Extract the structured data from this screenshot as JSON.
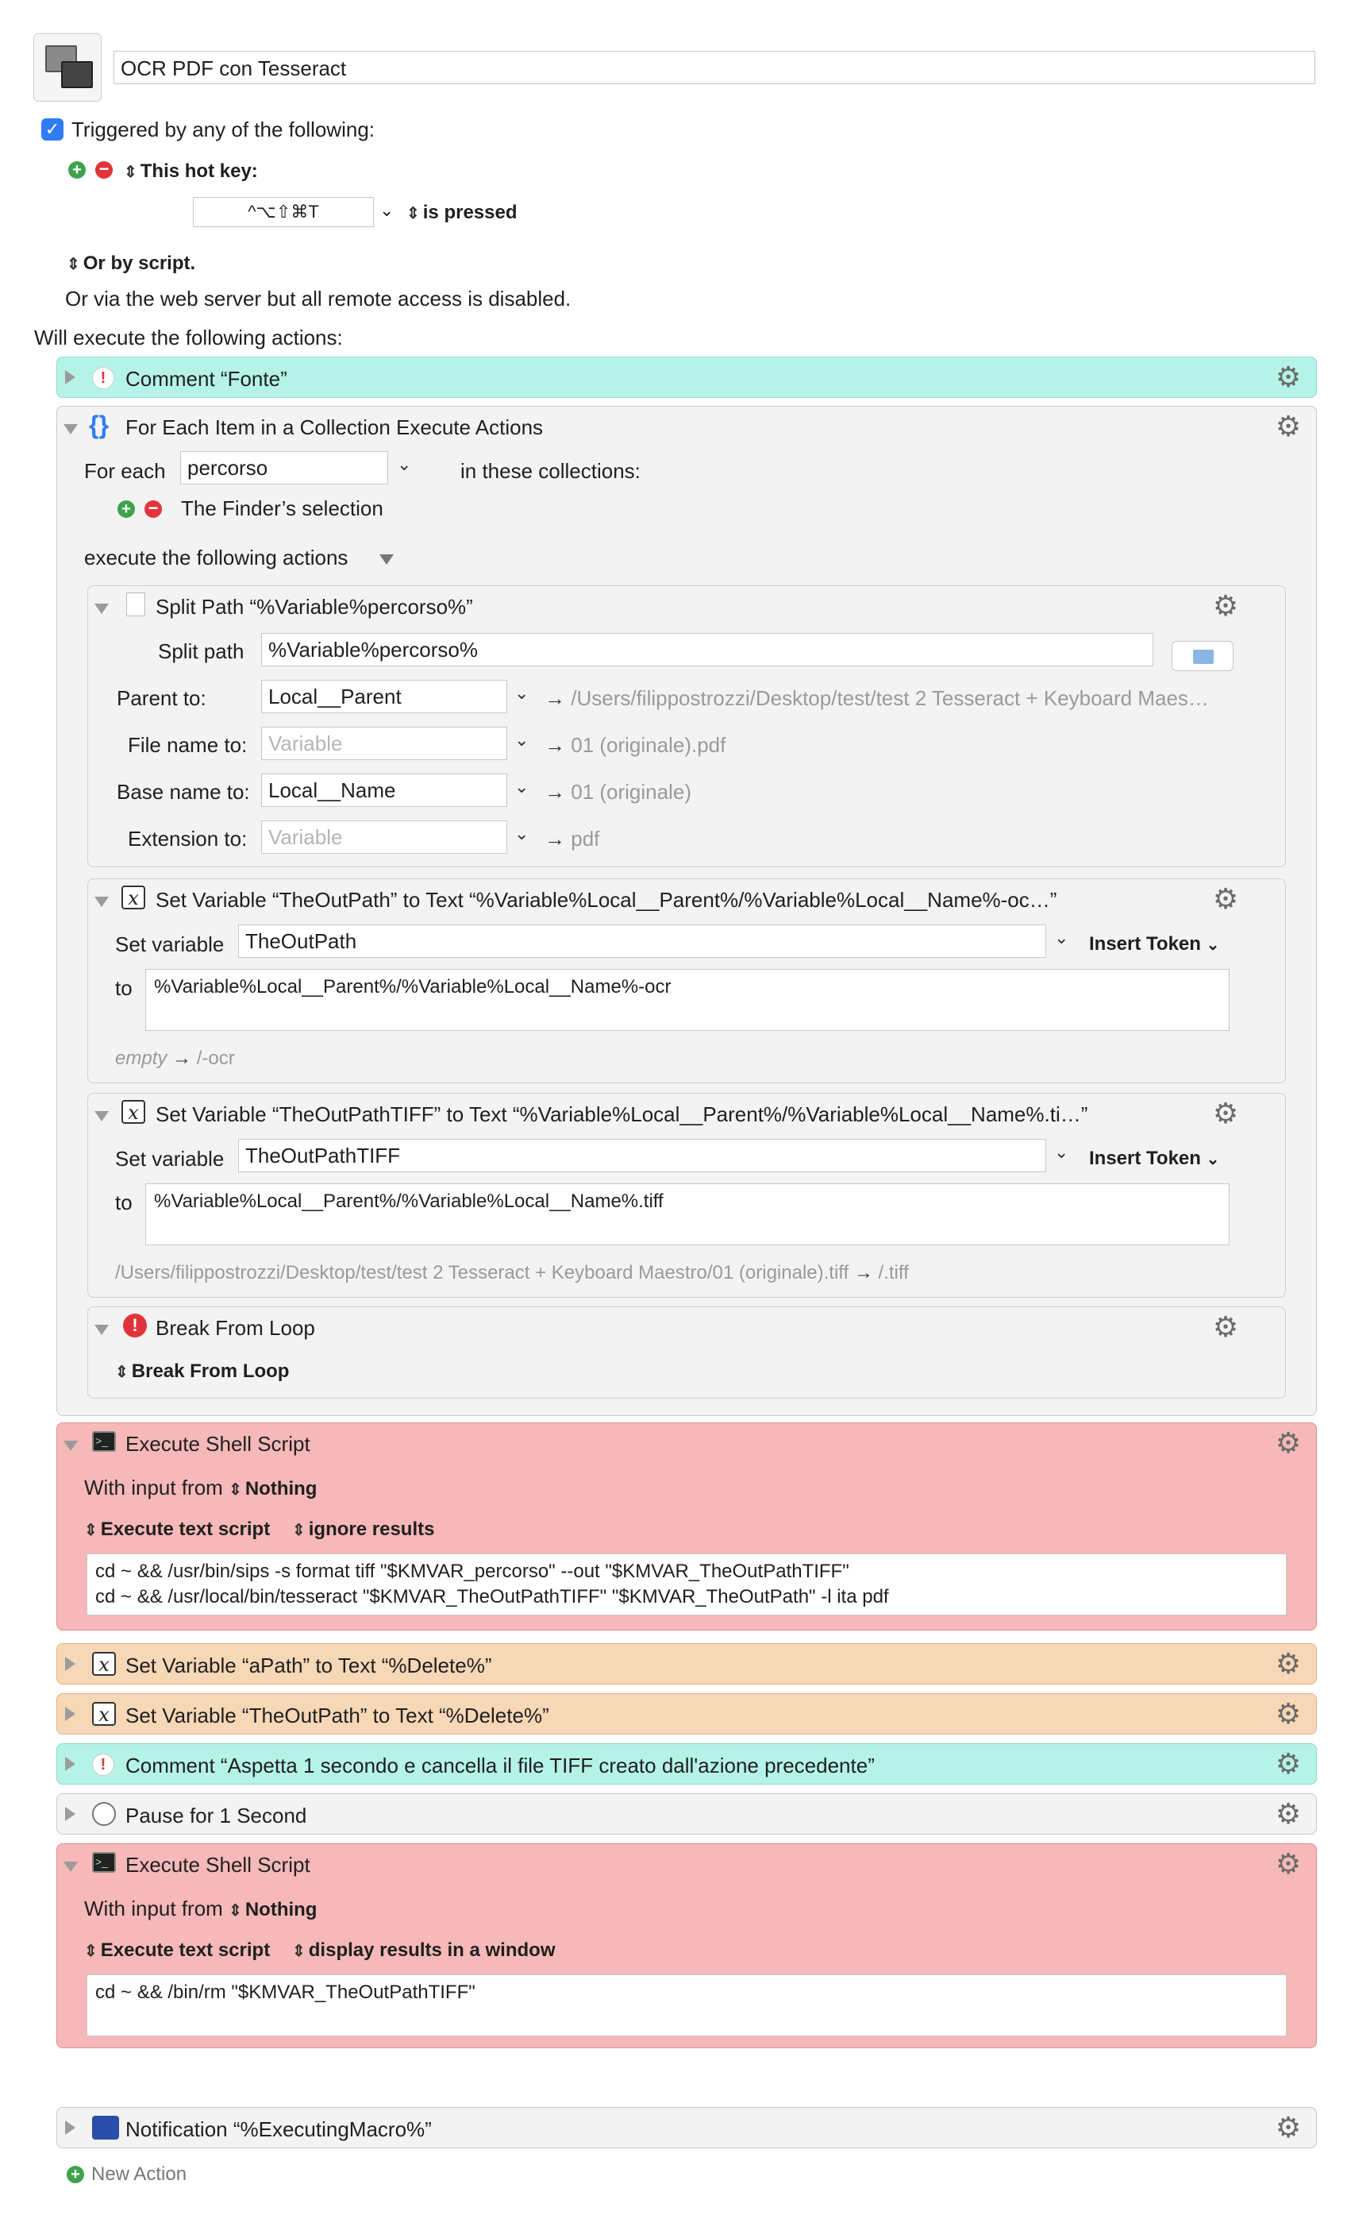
{
  "macro": {
    "name": "OCR PDF con Tesseract",
    "triggered_label": "Triggered by any of the following:",
    "hotkey_label": "This hot key:",
    "hotkey_value": "^⌥⇧⌘T",
    "hotkey_condition": "is pressed",
    "or_by_script": "Or by script.",
    "web_server_note": "Or via the web server but all remote access is disabled.",
    "will_execute": "Will execute the following actions:"
  },
  "actions": {
    "comment_fonte": "Comment “Fonte”",
    "foreach": {
      "title": "For Each Item in a Collection Execute Actions",
      "for_each_label": "For each",
      "variable": "percorso",
      "in_collections": "in these collections:",
      "collection": "The Finder’s selection",
      "execute_label": "execute the following actions"
    },
    "split": {
      "title": "Split Path “%Variable%percorso%”",
      "split_path_label": "Split path",
      "split_path_value": "%Variable%percorso%",
      "parent_label": "Parent to:",
      "parent_value": "Local__Parent",
      "parent_result": "/Users/filippostrozzi/Desktop/test/test 2 Tesseract + Keyboard Maes…",
      "filename_label": "File name to:",
      "filename_placeholder": "Variable",
      "filename_result": "01 (originale).pdf",
      "basename_label": "Base name to:",
      "basename_value": "Local__Name",
      "basename_result": "01 (originale)",
      "ext_label": "Extension to:",
      "ext_placeholder": "Variable",
      "ext_result": "pdf"
    },
    "setvar1": {
      "title": "Set Variable “TheOutPath” to Text “%Variable%Local__Parent%/%Variable%Local__Name%-oc…”",
      "set_label": "Set variable",
      "var_name": "TheOutPath",
      "insert_token": "Insert Token",
      "to_label": "to",
      "text": "%Variable%Local__Parent%/%Variable%Local__Name%-ocr",
      "preview_empty": "empty",
      "preview_result": "/-ocr"
    },
    "setvar2": {
      "title": "Set Variable “TheOutPathTIFF” to Text “%Variable%Local__Parent%/%Variable%Local__Name%.ti…”",
      "set_label": "Set variable",
      "var_name": "TheOutPathTIFF",
      "insert_token": "Insert Token",
      "to_label": "to",
      "text": "%Variable%Local__Parent%/%Variable%Local__Name%.tiff",
      "preview_source": "/Users/filippostrozzi/Desktop/test/test 2 Tesseract + Keyboard Maestro/01 (originale).tiff",
      "preview_result": "/.tiff"
    },
    "breakloop": {
      "title": "Break From Loop",
      "option": "Break From Loop"
    },
    "shell1": {
      "title": "Execute Shell Script",
      "input_label": "With input from",
      "input_value": "Nothing",
      "mode": "Execute text script",
      "results": "ignore results",
      "script": "cd ~ && /usr/bin/sips -s format tiff \"$KMVAR_percorso\" --out \"$KMVAR_TheOutPathTIFF\"\ncd ~ && /usr/local/bin/tesseract \"$KMVAR_TheOutPathTIFF\" \"$KMVAR_TheOutPath\" -l ita pdf"
    },
    "setvar_apath": "Set Variable “aPath” to Text “%Delete%”",
    "setvar_outpath": "Set Variable “TheOutPath” to Text “%Delete%”",
    "comment_wait": "Comment “Aspetta 1 secondo e cancella il file TIFF creato dall'azione precedente”",
    "pause": "Pause for 1 Second",
    "shell2": {
      "title": "Execute Shell Script",
      "input_label": "With input from",
      "input_value": "Nothing",
      "mode": "Execute text script",
      "results": "display results in a window",
      "script": "cd ~ && /bin/rm \"$KMVAR_TheOutPathTIFF\""
    },
    "notification": "Notification “%ExecutingMacro%”",
    "new_action": "New Action"
  },
  "icons": {
    "gear": "gear-icon",
    "comment": "exclamation-icon",
    "variable": "x-variable-icon",
    "shell": "terminal-icon",
    "foreach": "braces-icon"
  },
  "colors": {
    "teal": "#b5f3e8",
    "red": "#f6b8b8",
    "orange": "#f6d7b6",
    "accent": "#2f7cf6"
  }
}
